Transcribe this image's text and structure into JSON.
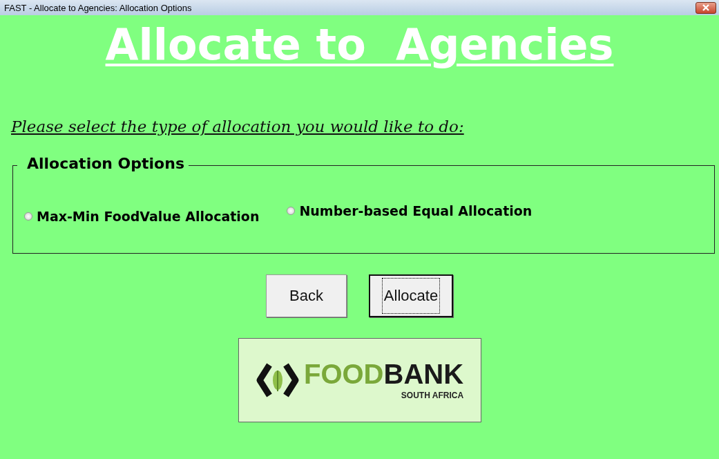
{
  "window": {
    "title": "FAST - Allocate to Agencies: Allocation Options"
  },
  "heading": "Allocate to  Agencies",
  "instruction": "Please select the type of allocation you would like to do:",
  "allocation_options": {
    "legend": "Allocation Options",
    "options": [
      {
        "label": "Max-Min FoodValue Allocation",
        "selected": false
      },
      {
        "label": "Number-based Equal Allocation",
        "selected": false
      }
    ]
  },
  "buttons": [
    {
      "label": "Back",
      "focused": false
    },
    {
      "label": "Allocate",
      "focused": true
    }
  ],
  "logo": {
    "word_parts": [
      {
        "text": "FOOD",
        "color": "#7aa83a"
      },
      {
        "text": "BANK",
        "color": "#1a1a1a"
      }
    ],
    "subtitle": "SOUTH AFRICA"
  }
}
